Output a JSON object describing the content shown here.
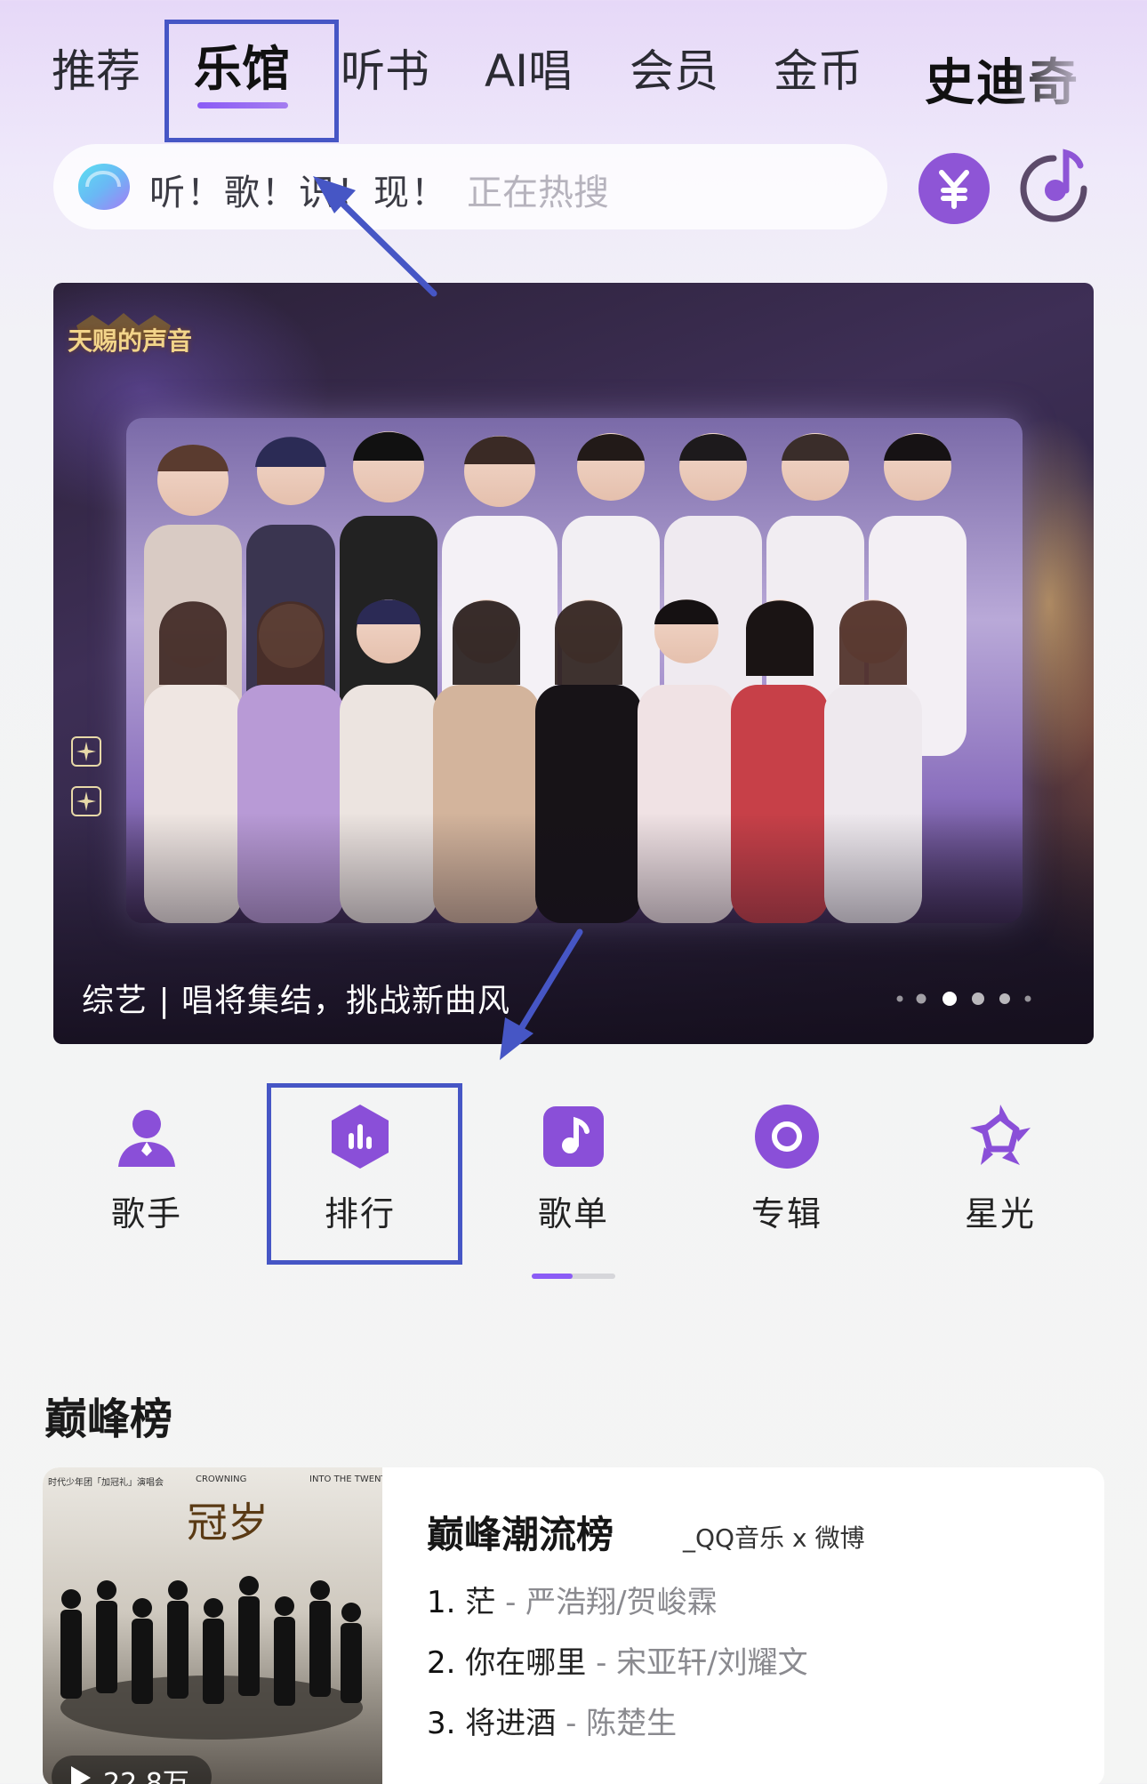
{
  "tabs": [
    {
      "label": "推荐"
    },
    {
      "label": "乐馆"
    },
    {
      "label": "听书"
    },
    {
      "label": "AI唱"
    },
    {
      "label": "会员"
    },
    {
      "label": "金币"
    }
  ],
  "active_tab": "乐馆",
  "brand_tab": "史迪奇",
  "search": {
    "text": "听！歌！识！现！",
    "hint": "正在热搜"
  },
  "banner": {
    "logo_text": "天赐的声音",
    "caption": "综艺 | 唱将集结，挑战新曲风",
    "page_count": 6,
    "active_page": 3
  },
  "categories": [
    {
      "label": "歌手",
      "icon": "singer-icon"
    },
    {
      "label": "排行",
      "icon": "ranking-icon"
    },
    {
      "label": "歌单",
      "icon": "playlist-icon"
    },
    {
      "label": "专辑",
      "icon": "album-icon"
    },
    {
      "label": "星光",
      "icon": "starlight-icon"
    }
  ],
  "section": {
    "title": "巅峰榜"
  },
  "chart": {
    "name": "巅峰潮流榜",
    "subtitle": "_QQ音乐 x 微博",
    "play_count": "22.8万",
    "cover": {
      "title": "冠岁",
      "top_left": "时代少年团「加冠礼」演唱会",
      "top_mid": "CROWNING",
      "top_right": "INTO THE TWENTIES"
    },
    "rows": [
      {
        "rank": "1.",
        "song": "茫",
        "artist": " - 严浩翔/贺峻霖"
      },
      {
        "rank": "2.",
        "song": "你在哪里",
        "artist": " - 宋亚轩/刘耀文"
      },
      {
        "rank": "3.",
        "song": "将进酒",
        "artist": " - 陈楚生"
      }
    ]
  },
  "colors": {
    "accent": "#8b5cf6",
    "annotation": "#4656c5"
  }
}
